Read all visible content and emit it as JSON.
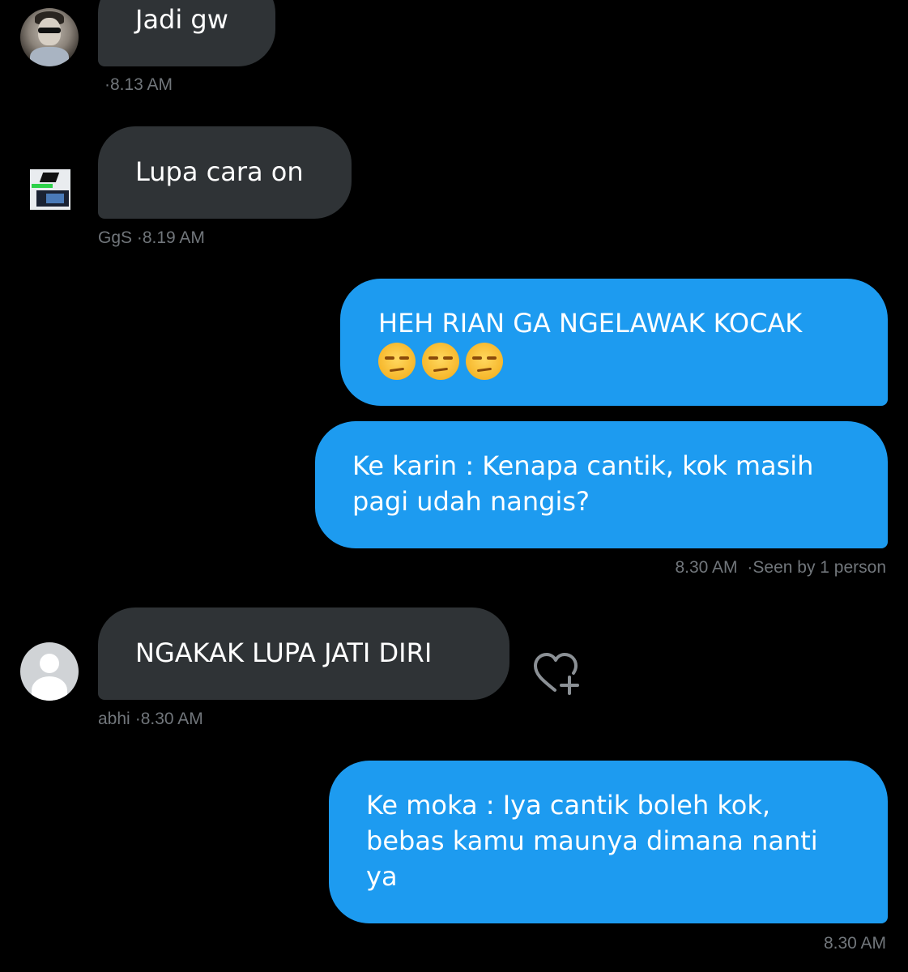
{
  "messages": [
    {
      "sender": "other",
      "text": "Jadi gw",
      "meta": "·8.13 AM"
    },
    {
      "sender": "other",
      "text": "Lupa cara on",
      "meta": "GgS ·8.19 AM"
    },
    {
      "sender": "self",
      "text": "HEH RIAN GA NGELAWAK KOCAK",
      "emoji": "unamused-face-emoji",
      "emoji_count": 3
    },
    {
      "sender": "self",
      "text_line1": "Ke karin : Kenapa cantik, kok masih",
      "text_line2": "pagi udah nangis?",
      "meta_time": "8.30 AM",
      "meta_seen": "·Seen by 1 person"
    },
    {
      "sender": "other",
      "text": "NGAKAK LUPA JATI DIRI",
      "meta_name": "abhi",
      "meta_time": "·8.30 AM"
    },
    {
      "sender": "self",
      "text_line1": "Ke moka : Iya cantik boleh kok,",
      "text_line2": "bebas kamu maunya dimana nanti",
      "text_line3": "ya",
      "meta": "8.30 AM"
    }
  ],
  "icons": {
    "react": "heart-plus-icon",
    "avatar_default": "person-icon"
  },
  "colors": {
    "background": "#000000",
    "incoming_bubble": "#2f3336",
    "outgoing_bubble": "#1d9bf0",
    "meta_text": "#71767b"
  }
}
